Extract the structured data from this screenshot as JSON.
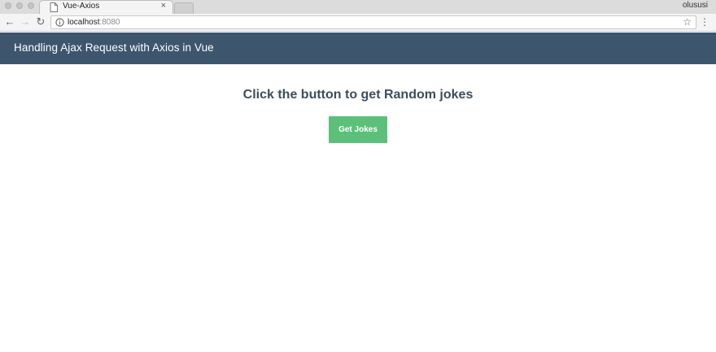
{
  "browser": {
    "tab_title": "Vue-Axios",
    "tab_close": "×",
    "profile_name": "olususi",
    "url_host": "localhost",
    "url_port": ":8080",
    "back_glyph": "←",
    "forward_glyph": "→",
    "reload_glyph": "↻",
    "star_glyph": "☆",
    "menu_glyph": "⋮",
    "icons": [
      "page-icon",
      "info-icon",
      "back-arrow-icon",
      "forward-arrow-icon",
      "reload-icon",
      "star-icon",
      "menu-icon"
    ]
  },
  "app": {
    "header_title": "Handling Ajax Request with Axios in Vue",
    "heading": "Click the button to get Random jokes",
    "button_label": "Get Jokes"
  },
  "colors": {
    "header_bg": "#3d566e",
    "button_bg": "#5cc07a",
    "heading_text": "#3d4d5e"
  }
}
